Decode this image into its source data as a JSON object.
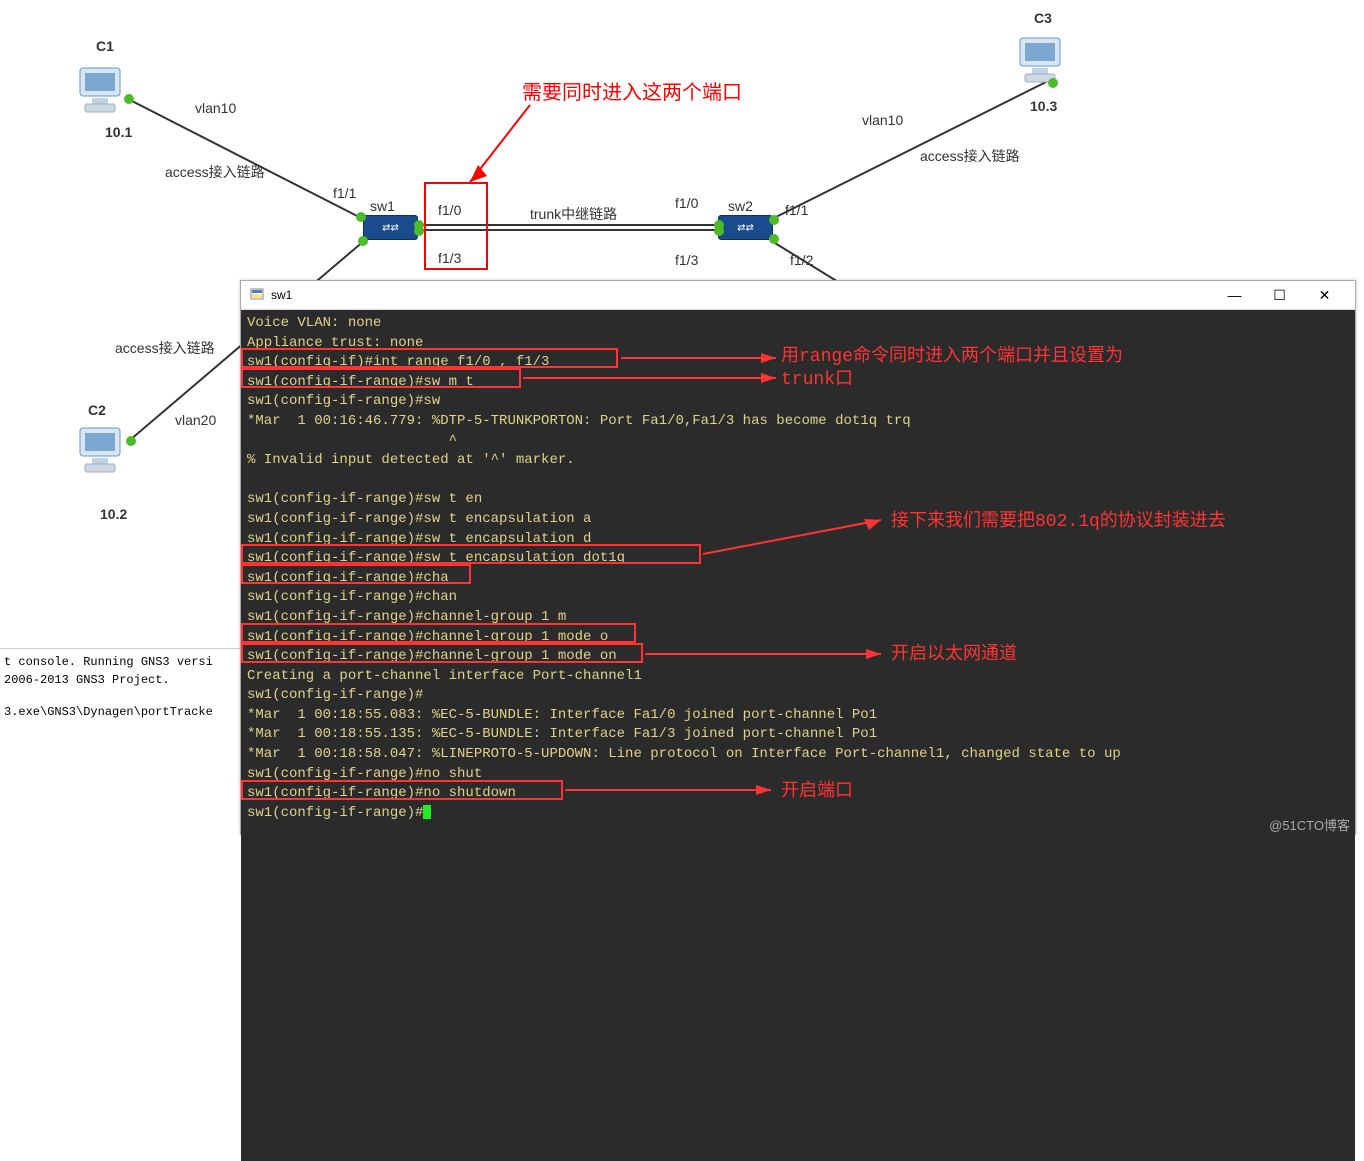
{
  "watermark": "@51CTO博客",
  "topology": {
    "pc1": {
      "name": "C1",
      "ip": "10.1"
    },
    "pc2": {
      "name": "C2",
      "ip": "10.2"
    },
    "pc3": {
      "name": "C3",
      "ip": "10.3"
    },
    "sw1": "sw1",
    "sw2": "sw2",
    "labels": {
      "vlan10_left": "vlan10",
      "vlan10_right": "vlan10",
      "vlan20": "vlan20",
      "access_left_top": "access接入链路",
      "access_right": "access接入链路",
      "access_left_bottom": "access接入链路",
      "trunk": "trunk中继链路",
      "f11_left": "f1/1",
      "f10_box": "f1/0",
      "f13_box": "f1/3",
      "f10_right": "f1/0",
      "f11_right": "f1/1",
      "f13_right": "f1/3",
      "f12_right": "f1/2"
    },
    "annotation": "需要同时进入这两个端口"
  },
  "terminal": {
    "title": "sw1",
    "lines": [
      "Voice VLAN: none",
      "Appliance trust: none",
      "sw1(config-if)#int range f1/0 , f1/3",
      "sw1(config-if-range)#sw m t",
      "sw1(config-if-range)#sw",
      "*Mar  1 00:16:46.779: %DTP-5-TRUNKPORTON: Port Fa1/0,Fa1/3 has become dot1q trq",
      "                        ^",
      "% Invalid input detected at '^' marker.",
      "",
      "sw1(config-if-range)#sw t en",
      "sw1(config-if-range)#sw t encapsulation a",
      "sw1(config-if-range)#sw t encapsulation d",
      "sw1(config-if-range)#sw t encapsulation dot1q",
      "sw1(config-if-range)#cha",
      "sw1(config-if-range)#chan",
      "sw1(config-if-range)#channel-group 1 m",
      "sw1(config-if-range)#channel-group 1 mode o",
      "sw1(config-if-range)#channel-group 1 mode on",
      "Creating a port-channel interface Port-channel1",
      "sw1(config-if-range)#",
      "*Mar  1 00:18:55.083: %EC-5-BUNDLE: Interface Fa1/0 joined port-channel Po1",
      "*Mar  1 00:18:55.135: %EC-5-BUNDLE: Interface Fa1/3 joined port-channel Po1",
      "*Mar  1 00:18:58.047: %LINEPROTO-5-UPDOWN: Line protocol on Interface Port-channel1, changed state to up",
      "sw1(config-if-range)#no shut",
      "sw1(config-if-range)#no shutdown",
      "sw1(config-if-range)#"
    ],
    "annotations": {
      "range_cmd": "用range命令同时进入两个端口并且设置为trunk口",
      "encap": "接下来我们需要把802.1q的协议封装进去",
      "etherchannel": "开启以太网通道",
      "no_shut": "开启端口"
    }
  },
  "left_console": {
    "line1": "t console. Running GNS3 versi",
    "line2": "2006-2013 GNS3 Project.",
    "line3": "3.exe\\GNS3\\Dynagen\\portTracke"
  }
}
